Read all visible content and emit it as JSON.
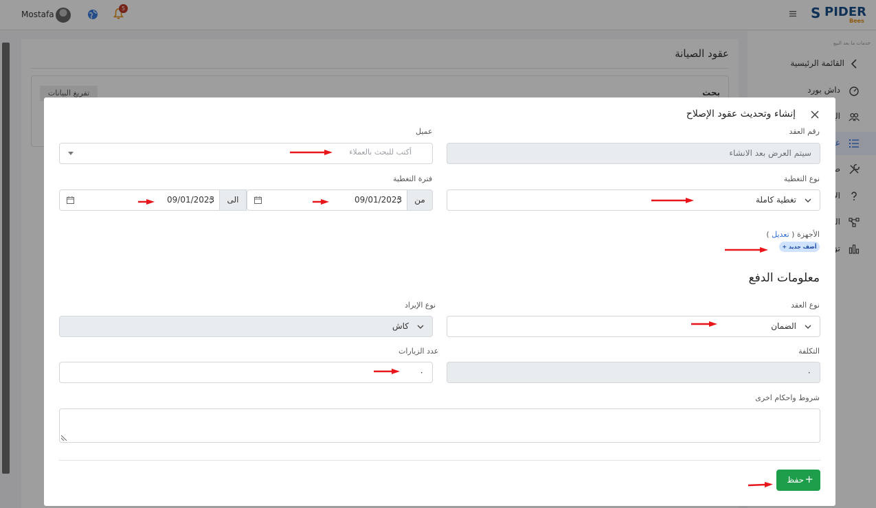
{
  "topbar": {
    "user_name": "Mostafa",
    "notification_count": "5",
    "logo_text": "PIDER",
    "logo_letter": "S",
    "logo_sub": "Bees"
  },
  "sidebar": {
    "caption": "خدمات ما بعد البيع",
    "back_label": "القائمة الرئيسية",
    "items": [
      {
        "label": "داش بورد",
        "icon": "dashboard-icon"
      },
      {
        "label": "الع",
        "icon": "users-icon"
      },
      {
        "label": "عق",
        "icon": "list-icon",
        "active": true
      },
      {
        "label": "ط",
        "icon": "tools-icon"
      },
      {
        "label": "الإ",
        "icon": "question-icon"
      },
      {
        "label": "الم",
        "icon": "flow-icon"
      },
      {
        "label": "تق",
        "icon": "chart-icon"
      }
    ]
  },
  "page": {
    "title": "عقود الصيانة",
    "search_title": "بحث",
    "clear_label": "تفريغ البيانات"
  },
  "modal": {
    "title": "إنشاء وتحديث عقود الإصلاح",
    "contract_number": {
      "label": "رقم العقد",
      "value": "سيتم العرض بعد الانشاء"
    },
    "client": {
      "label": "عميل",
      "placeholder": "أكتب للبحث بالعملاء"
    },
    "coverage_type": {
      "label": "نوع التغطية",
      "value": "تغطية كاملة"
    },
    "coverage_period": {
      "label": "فترة التغطية",
      "from_label": "من",
      "from_value": "09/01/2023",
      "to_label": "الى",
      "to_value": "09/01/2023"
    },
    "devices": {
      "label": "الأجهزة (",
      "edit_label": "تعديل",
      "close_paren": " )",
      "add_new": "+ أضف جديد"
    },
    "payment_section_title": "معلومات الدفع",
    "contract_type": {
      "label": "نوع العقد",
      "value": "الضمان"
    },
    "revenue_type": {
      "label": "نوع الإيراد",
      "value": "كاش"
    },
    "cost": {
      "label": "التكلفة",
      "value": "٠"
    },
    "visits": {
      "label": "عدد الزيارات",
      "value": "٠"
    },
    "terms": {
      "label": "شروط واحكام اخرى",
      "value": ""
    },
    "save_label": "حفظ"
  },
  "colors": {
    "primary_green": "#1e9e4a",
    "annotation_red": "#e8161b",
    "brand_blue": "#1a4f8b",
    "brand_orange": "#e69018"
  }
}
